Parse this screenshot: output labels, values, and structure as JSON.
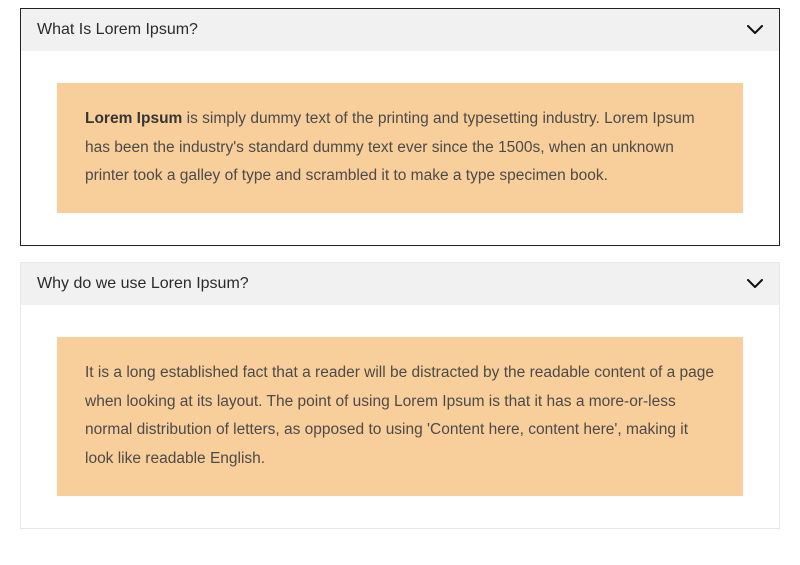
{
  "accordion": [
    {
      "title": "What Is Lorem Ipsum?",
      "body_bold": "Lorem Ipsum",
      "body_text": " is simply dummy text of the printing and typesetting industry. Lorem Ipsum has been the industry's standard dummy text ever since the 1500s, when an unknown printer took a galley of type and scrambled it to make a type specimen book."
    },
    {
      "title": "Why do we use Loren Ipsum?",
      "body_bold": "",
      "body_text": "It is a long established fact that a reader will be distracted by the readable content of a page when looking at its layout. The point of using Lorem Ipsum is that it has a more-or-less normal distribution of letters, as opposed to using 'Content here, content here', making it look like readable English."
    }
  ],
  "colors": {
    "highlight_bg": "#f8ce9a",
    "header_bg": "#f1f1f1"
  }
}
